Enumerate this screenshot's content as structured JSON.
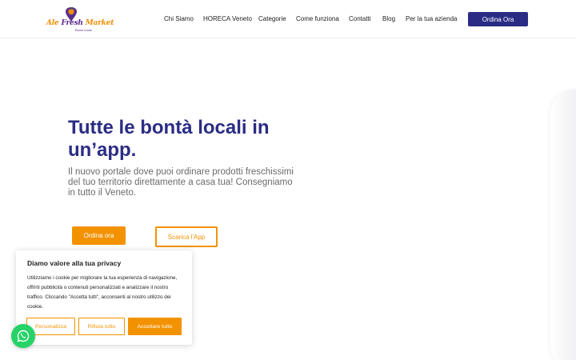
{
  "header": {
    "logo": {
      "brand_left": "Ale ",
      "brand_mid": "Fresh",
      "brand_right": " Market",
      "tagline": "Buoni locali",
      "icon": "apple-pin-icon",
      "colors": {
        "orange": "#f08c00",
        "purple": "#5a2d8c"
      }
    },
    "nav": [
      {
        "label": "Chi Siamo"
      },
      {
        "label": "HORECA Veneto"
      },
      {
        "label": "Categorie"
      },
      {
        "label": "Come funziona"
      },
      {
        "label": "Contatti"
      },
      {
        "label": "Blog"
      },
      {
        "label": "Per la tua azienda"
      }
    ],
    "cta_label": "Ordina Ora"
  },
  "hero": {
    "title": "Tutte le bontà locali in un’app.",
    "subtitle": "Il nuovo portale dove puoi ordinare prodotti freschissimi del tuo territorio direttamente a casa tua! Consegniamo in tutto il Veneto.",
    "primary_label": "Ordina ora",
    "secondary_label": "Scarica l'App"
  },
  "cookie": {
    "title": "Diamo valore alla tua privacy",
    "text": "Utilizziamo i cookie per migliorare la tua esperienza di navigazione, offrirti pubblicità o contenuti personalizzati e analizzare il nostro traffico. Cliccando \"Accetta tutti\", acconsenti al nostro utilizzo dei cookie.",
    "customize_label": "Personalizza",
    "reject_label": "Rifiuta tutto",
    "accept_label": "Accettare tutto"
  },
  "chat": {
    "icon": "whatsapp-icon"
  },
  "colors": {
    "navy": "#2a2c84",
    "orange": "#f39200",
    "green": "#25d366",
    "gray_text": "#6b6b6b"
  }
}
